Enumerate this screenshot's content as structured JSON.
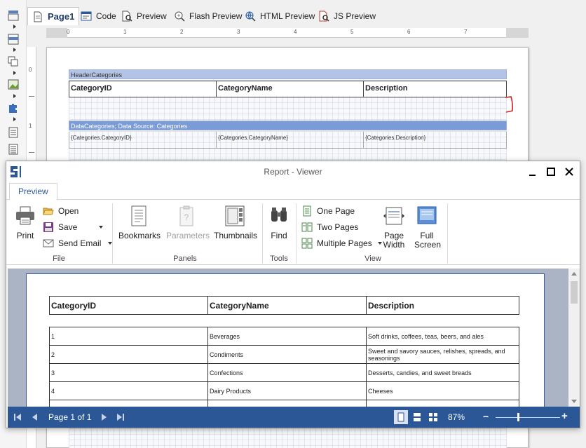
{
  "designer": {
    "tabs": [
      {
        "label": "Page1",
        "icon": "page-icon"
      },
      {
        "label": "Code",
        "icon": "code-icon"
      },
      {
        "label": "Preview",
        "icon": "preview-icon"
      },
      {
        "label": "Flash Preview",
        "icon": "flash-preview-icon"
      },
      {
        "label": "HTML Preview",
        "icon": "html-preview-icon"
      },
      {
        "label": "JS Preview",
        "icon": "js-preview-icon"
      }
    ],
    "ruler_h": [
      "0",
      "1",
      "2",
      "3",
      "4",
      "5",
      "6",
      "7"
    ],
    "ruler_v": [
      "0",
      "1"
    ],
    "header_band": {
      "title": "HeaderCategories",
      "columns": [
        "CategoryID",
        "CategoryName",
        "Description"
      ]
    },
    "data_band": {
      "title": "DataCategories; Data Source: Categories",
      "fields": [
        "{Categories.CategoryID}",
        "{Categories.CategoryName}",
        "{Categories.Description}"
      ]
    }
  },
  "viewer": {
    "title": "Report - Viewer",
    "ribbon_tab": "Preview",
    "file_group": {
      "label": "File",
      "print": "Print",
      "open": "Open",
      "save": "Save",
      "send_email": "Send Email"
    },
    "panels_group": {
      "label": "Panels",
      "bookmarks": "Bookmarks",
      "parameters": "Parameters",
      "thumbnails": "Thumbnails"
    },
    "tools_group": {
      "label": "Tools",
      "find": "Find"
    },
    "view_group": {
      "label": "View",
      "one_page": "One Page",
      "two_pages": "Two Pages",
      "multiple_pages": "Multiple Pages",
      "page_width_1": "Page",
      "page_width_2": "Width",
      "full_screen_1": "Full",
      "full_screen_2": "Screen"
    },
    "report": {
      "columns": [
        "CategoryID",
        "CategoryName",
        "Description"
      ],
      "rows": [
        [
          "1",
          "Beverages",
          "Soft drinks, coffees, teas, beers, and ales"
        ],
        [
          "2",
          "Condiments",
          "Sweet and savory sauces, relishes, spreads, and seasonings"
        ],
        [
          "3",
          "Confections",
          "Desserts, candies, and sweet breads"
        ],
        [
          "4",
          "Dairy Products",
          "Cheeses"
        ],
        [
          "",
          "",
          ""
        ]
      ]
    },
    "status": {
      "page_info": "Page 1 of 1",
      "zoom": "87%",
      "zoom_minus": "−",
      "zoom_plus": "+",
      "zoom_level": 0.35
    },
    "colors": {
      "accent": "#2b5797",
      "preview_bg": "#aab4c5"
    }
  }
}
